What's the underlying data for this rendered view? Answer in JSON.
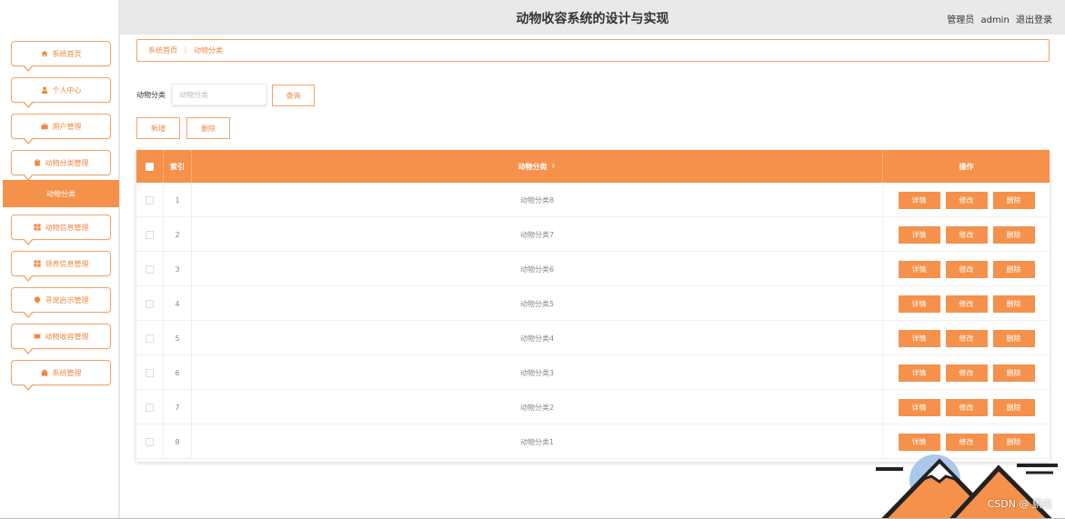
{
  "header": {
    "title": "动物收容系统的设计与实现",
    "user_role": "管理员",
    "username": "admin",
    "logout_label": "退出登录"
  },
  "sidebar": {
    "items": [
      {
        "label": "系统首页",
        "icon": "home-icon"
      },
      {
        "label": "个人中心",
        "icon": "user-icon"
      },
      {
        "label": "用户管理",
        "icon": "briefcase-icon"
      },
      {
        "label": "动物分类管理",
        "icon": "clipboard-icon"
      },
      {
        "label": "动物信息管理",
        "icon": "grid-icon"
      },
      {
        "label": "领养信息管理",
        "icon": "grid-icon"
      },
      {
        "label": "寻宠启示管理",
        "icon": "pin-icon"
      },
      {
        "label": "动物收容管理",
        "icon": "ticket-icon"
      },
      {
        "label": "系统管理",
        "icon": "box-icon"
      }
    ],
    "active_sub_item": "动物分类"
  },
  "breadcrumb": {
    "home": "系统首页",
    "current": "动物分类"
  },
  "search": {
    "label": "动物分类",
    "placeholder": "动物分类",
    "value": "",
    "search_button": "查询"
  },
  "actions": {
    "add_button": "新增",
    "delete_button": "删除"
  },
  "table": {
    "columns": [
      "索引",
      "动物分类",
      "操作"
    ],
    "row_actions": [
      "详情",
      "修改",
      "删除"
    ],
    "rows": [
      {
        "index": "1",
        "category": "动物分类8"
      },
      {
        "index": "2",
        "category": "动物分类7"
      },
      {
        "index": "3",
        "category": "动物分类6"
      },
      {
        "index": "4",
        "category": "动物分类5"
      },
      {
        "index": "5",
        "category": "动物分类4"
      },
      {
        "index": "6",
        "category": "动物分类3"
      },
      {
        "index": "7",
        "category": "动物分类2"
      },
      {
        "index": "8",
        "category": "动物分类1"
      }
    ]
  },
  "watermark": "CSDN @ 鹏白",
  "colors": {
    "accent": "#f5914a",
    "accent_text": "#f0883f",
    "header_bg": "#e9e9e9"
  }
}
